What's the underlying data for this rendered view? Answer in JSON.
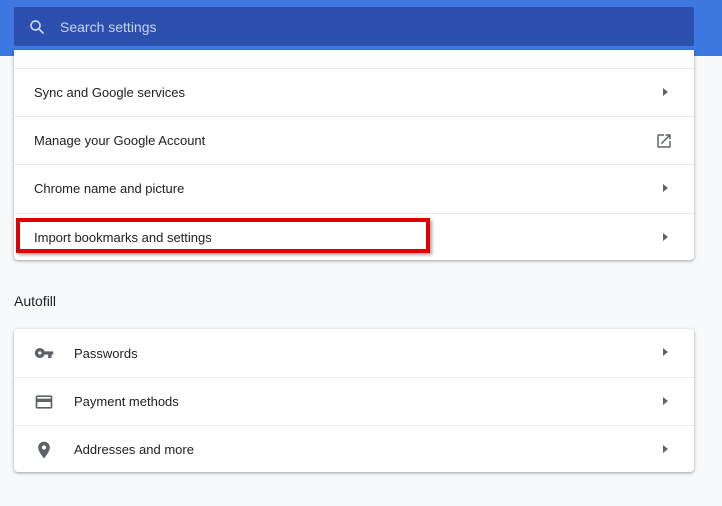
{
  "search": {
    "placeholder": "Search settings",
    "icon": "search-icon"
  },
  "you_and_google": {
    "items": [
      {
        "label": "Sync and Google services",
        "icon": "chevron-right-icon"
      },
      {
        "label": "Manage your Google Account",
        "icon": "open-in-new-icon"
      },
      {
        "label": "Chrome name and picture",
        "icon": "chevron-right-icon"
      },
      {
        "label": "Import bookmarks and settings",
        "icon": "chevron-right-icon"
      }
    ]
  },
  "autofill": {
    "title": "Autofill",
    "items": [
      {
        "label": "Passwords",
        "icon": "key-icon"
      },
      {
        "label": "Payment methods",
        "icon": "credit-card-icon"
      },
      {
        "label": "Addresses and more",
        "icon": "location-pin-icon"
      }
    ]
  },
  "colors": {
    "topbar": "#3c78e0",
    "search_bg": "#2c4fae",
    "highlight": "#e00000"
  }
}
